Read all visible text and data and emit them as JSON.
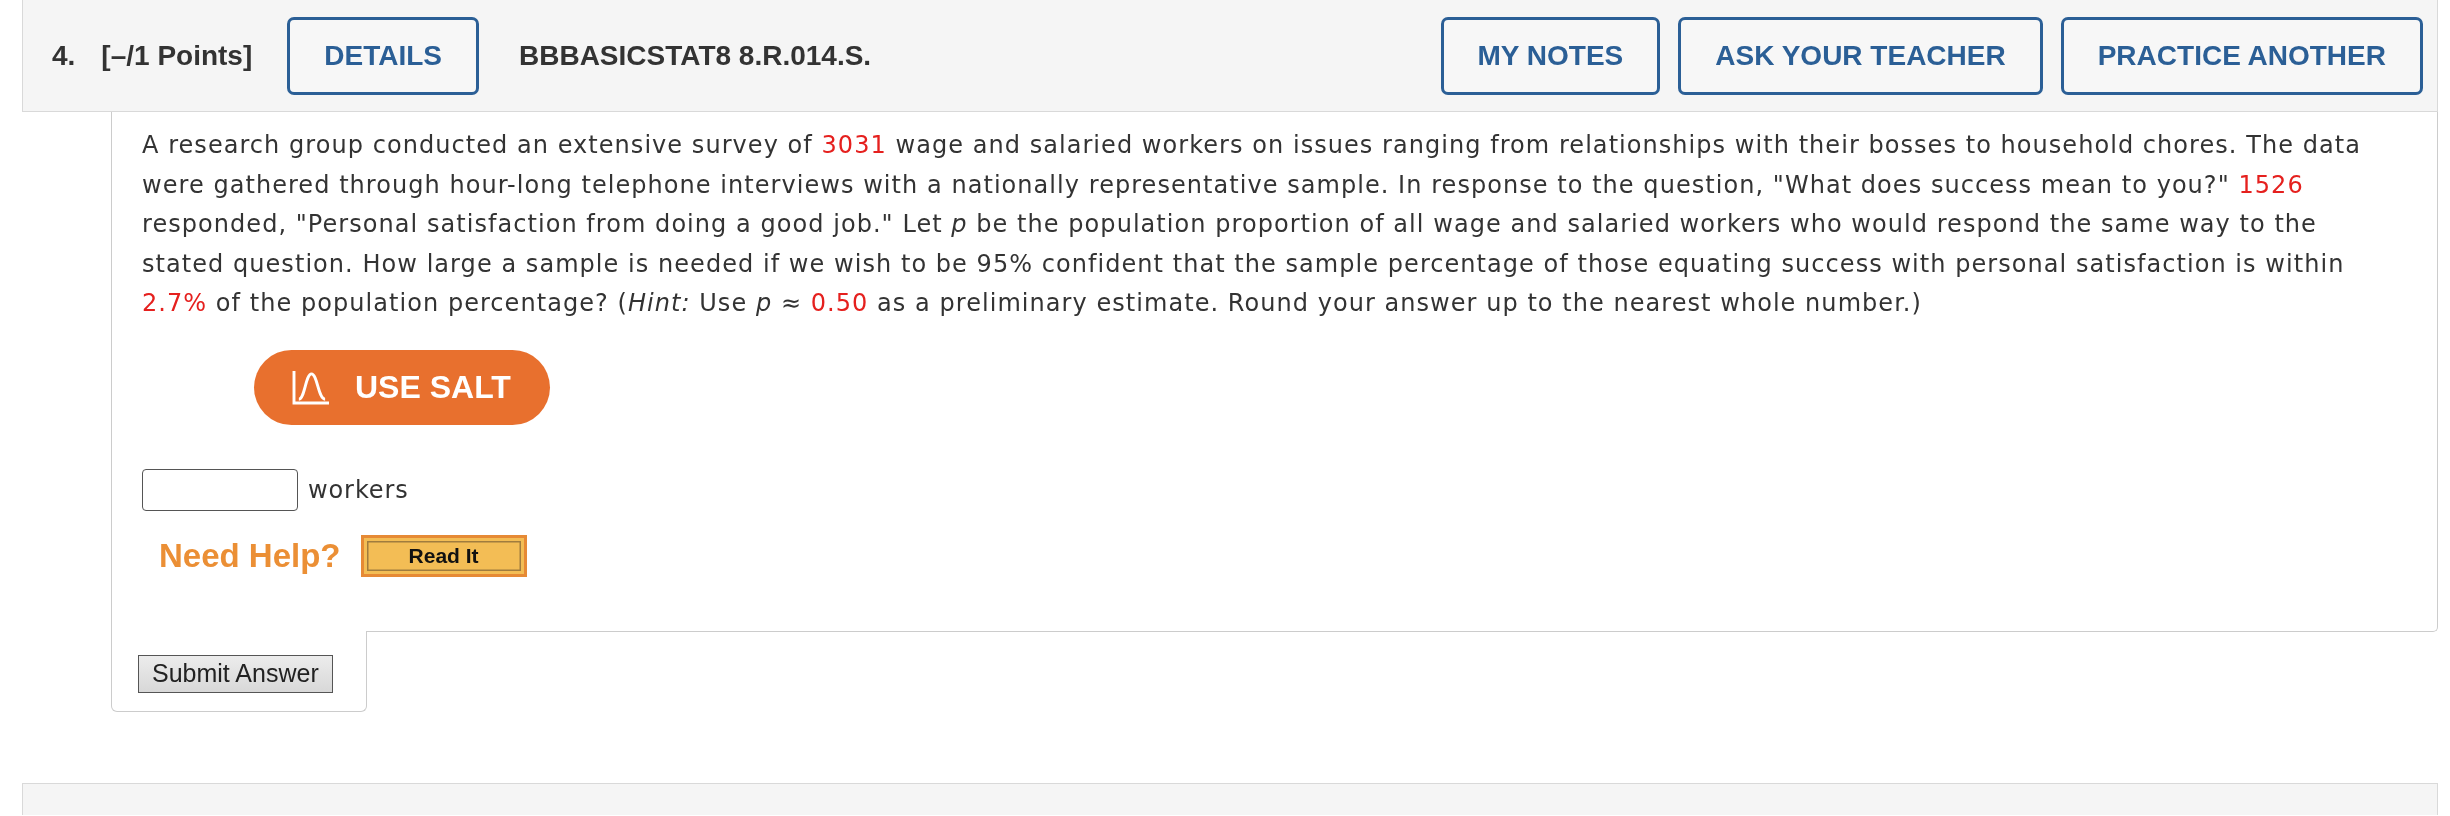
{
  "question_header": {
    "number": "4.",
    "points": "[–/1 Points]",
    "details_button": "DETAILS",
    "code": "BBBASICSTAT8 8.R.014.S.",
    "actions": [
      "MY NOTES",
      "ASK YOUR TEACHER",
      "PRACTICE ANOTHER"
    ]
  },
  "question": {
    "lines": [
      [
        {
          "kind": "text",
          "text": "A research group conducted an extensive survey of "
        },
        {
          "kind": "value",
          "text": "3031"
        },
        {
          "kind": "text",
          "text": " wage and salaried workers on issues ranging from relationships with their bosses to household chores. The data"
        }
      ],
      [
        {
          "kind": "text",
          "text": "were gathered through hour-long telephone interviews with a nationally representative sample. In response to the question, \"What does success mean to you?\" "
        },
        {
          "kind": "value",
          "text": "1526"
        }
      ],
      [
        {
          "kind": "text",
          "text": "responded, \"Personal satisfaction from doing a good job.\" Let *p* be the population proportion of all wage and salaried workers who would respond the same way to the"
        }
      ],
      [
        {
          "kind": "text",
          "text": "stated question. How large a sample is needed if we wish to be 95% confident that the sample percentage of those equating success with personal satisfaction is within"
        }
      ],
      [
        {
          "kind": "value",
          "text": "2.7%"
        },
        {
          "kind": "text",
          "text": " of the population percentage? (*Hint:* Use *p* ≈ "
        },
        {
          "kind": "value",
          "text": "0.50"
        },
        {
          "kind": "text",
          "text": " as a preliminary estimate. Round your answer up to the nearest whole number.)"
        }
      ]
    ]
  },
  "salt_button": "USE SALT",
  "answer": {
    "unit": "workers"
  },
  "help": {
    "label": "Need Help?",
    "buttons": [
      "Read It"
    ]
  },
  "submit_button": "Submit Answer"
}
